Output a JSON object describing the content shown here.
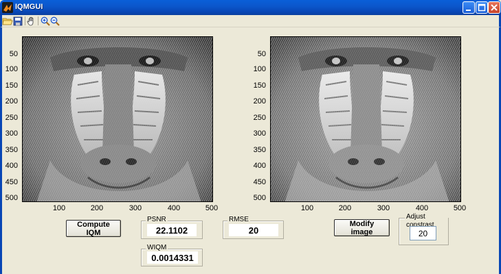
{
  "window": {
    "title": "IQMGUI"
  },
  "toolbar": {
    "icons": [
      "open-folder-icon",
      "save-disk-icon",
      "pan-hand-icon",
      "zoom-in-icon",
      "zoom-out-icon"
    ]
  },
  "axes_left": {
    "y_ticks": [
      "50",
      "100",
      "150",
      "200",
      "250",
      "300",
      "350",
      "400",
      "450",
      "500"
    ],
    "x_ticks": [
      "100",
      "200",
      "300",
      "400",
      "500"
    ]
  },
  "axes_right": {
    "y_ticks": [
      "50",
      "100",
      "150",
      "200",
      "250",
      "300",
      "350",
      "400",
      "450",
      "500"
    ],
    "x_ticks": [
      "100",
      "200",
      "300",
      "400",
      "500"
    ]
  },
  "controls": {
    "compute_label": "Compute IQM",
    "modify_label": "Modify image",
    "psnr": {
      "label": "PSNR",
      "value": "22.1102"
    },
    "rmse": {
      "label": "RMSE",
      "value": "20"
    },
    "wiqm": {
      "label": "WIQM",
      "value": "0.0014331"
    },
    "contrast": {
      "label": "Adjust constrast",
      "value": "20"
    }
  },
  "colors": {
    "titlebar": "#0a5fd8",
    "background": "#ece9d8",
    "close_button": "#c7422a"
  }
}
